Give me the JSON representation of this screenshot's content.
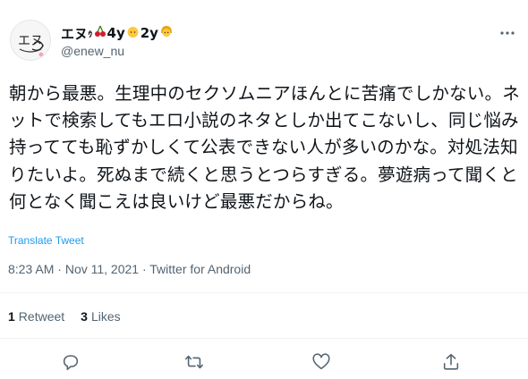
{
  "user": {
    "display_name": "エヌ",
    "small_kana": "ｩ",
    "badge_1_text": "4y",
    "badge_2_text": "2y",
    "handle": "@enew_nu",
    "avatar_text": "エヌ"
  },
  "tweet": {
    "text": "朝から最悪。生理中のセクソムニアほんとに苦痛でしかない。ネットで検索してもエロ小説のネタとしか出てこないし、同じ悩み持ってても恥ずかしくて公表できない人が多いのかな。対処法知りたいよ。死ぬまで続くと思うとつらすぎる。夢遊病って聞くと何となく聞こえは良いけど最悪だからね。",
    "translate_label": "Translate Tweet",
    "time": "8:23 AM",
    "date": "Nov 11, 2021",
    "separator": "·",
    "source": "Twitter for Android"
  },
  "stats": {
    "retweets_count": "1",
    "retweets_label": "Retweet",
    "likes_count": "3",
    "likes_label": "Likes"
  },
  "icons": {
    "more": "more-horizontal-icon",
    "reply": "reply-icon",
    "retweet": "retweet-icon",
    "like": "heart-icon",
    "share": "share-icon",
    "cherry": "cherries-emoji",
    "baby": "baby-emoji",
    "girl": "girl-emoji"
  },
  "colors": {
    "text": "#0f1419",
    "secondary": "#536471",
    "link": "#1d9bf0",
    "divider": "#eff3f4"
  }
}
